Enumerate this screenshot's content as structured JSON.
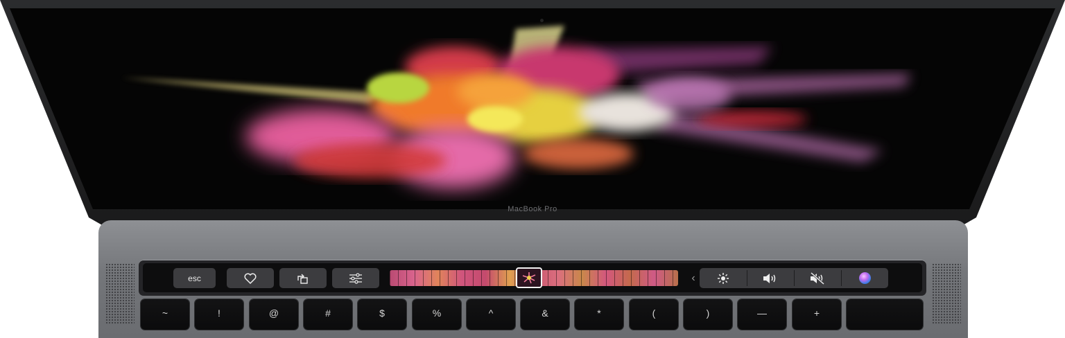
{
  "screen": {
    "brand_label": "MacBook Pro",
    "wallpaper": "colorful-powder-explosion"
  },
  "touch_bar": {
    "esc_label": "esc",
    "controls": [
      "heart-icon",
      "rotate-icon",
      "sliders-icon"
    ],
    "scrubber": "photo-thumbnail-strip",
    "control_strip": [
      "chevron-left-icon",
      "brightness-icon",
      "volume-icon",
      "mute-icon",
      "siri-icon"
    ]
  },
  "keyboard": {
    "row": [
      "~",
      "!",
      "@",
      "#",
      "$",
      "%",
      "^",
      "&",
      "*",
      "(",
      ")",
      "—",
      "+",
      ""
    ]
  }
}
